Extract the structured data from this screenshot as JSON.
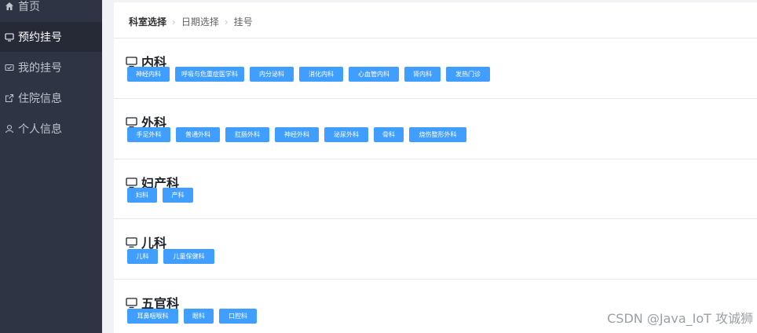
{
  "sidebar": {
    "items": [
      {
        "label": "首页",
        "icon": "home-icon"
      },
      {
        "label": "预约挂号",
        "icon": "monitor-icon"
      },
      {
        "label": "我的挂号",
        "icon": "message-icon"
      },
      {
        "label": "住院信息",
        "icon": "edit-icon"
      },
      {
        "label": "个人信息",
        "icon": "user-icon"
      }
    ],
    "active_index": 1
  },
  "breadcrumb": {
    "items": [
      "科室选择",
      "日期选择",
      "挂号"
    ],
    "active_index": 0
  },
  "departments": [
    {
      "title": "内科",
      "subs": [
        "神经内科",
        "呼吸与危重症医学科",
        "内分泌科",
        "消化内科",
        "心血管内科",
        "肾内科",
        "发热门诊"
      ]
    },
    {
      "title": "外科",
      "subs": [
        "手足外科",
        "普通外科",
        "肛肠外科",
        "神经外科",
        "泌尿外科",
        "骨科",
        "烧伤整形外科"
      ]
    },
    {
      "title": "妇产科",
      "subs": [
        "妇科",
        "产科"
      ]
    },
    {
      "title": "儿科",
      "subs": [
        "儿科",
        "儿童保健科"
      ]
    },
    {
      "title": "五官科",
      "subs": [
        "耳鼻咽喉科",
        "眼科",
        "口腔科"
      ]
    }
  ],
  "watermark": "CSDN @Java_IoT 攻诚狮",
  "colors": {
    "sidebar_bg": "#2f3445",
    "sidebar_active": "#262a37",
    "chip": "#409eff"
  }
}
